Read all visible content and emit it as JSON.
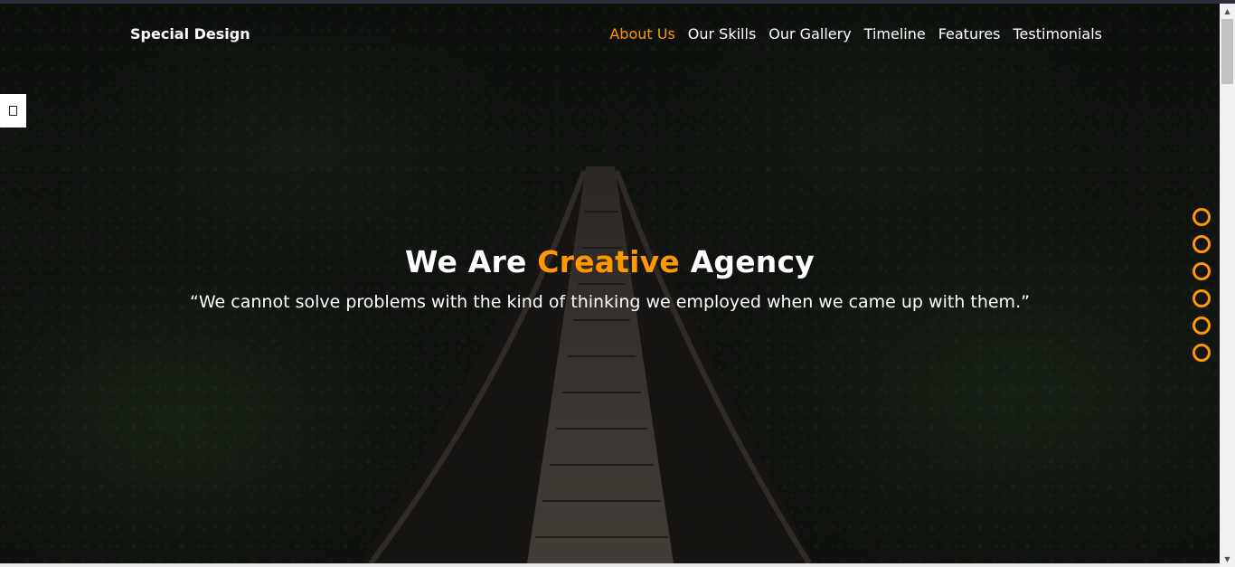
{
  "header": {
    "logo": "Special Design",
    "nav": [
      {
        "label": "About Us",
        "active": true
      },
      {
        "label": "Our Skills",
        "active": false
      },
      {
        "label": "Our Gallery",
        "active": false
      },
      {
        "label": "Timeline",
        "active": false
      },
      {
        "label": "Features",
        "active": false
      },
      {
        "label": "Testimonials",
        "active": false
      }
    ]
  },
  "settings": {
    "icon": "gear-icon",
    "glyph": "□"
  },
  "hero": {
    "title_prefix": "We Are ",
    "title_accent": "Creative",
    "title_suffix": " Agency",
    "quote": "“We cannot solve problems with the kind of thinking we employed when we came up with them.”"
  },
  "bullets": {
    "count": 6
  },
  "colors": {
    "accent": "#ff9800",
    "text": "#ffffff",
    "background": "#131612"
  }
}
